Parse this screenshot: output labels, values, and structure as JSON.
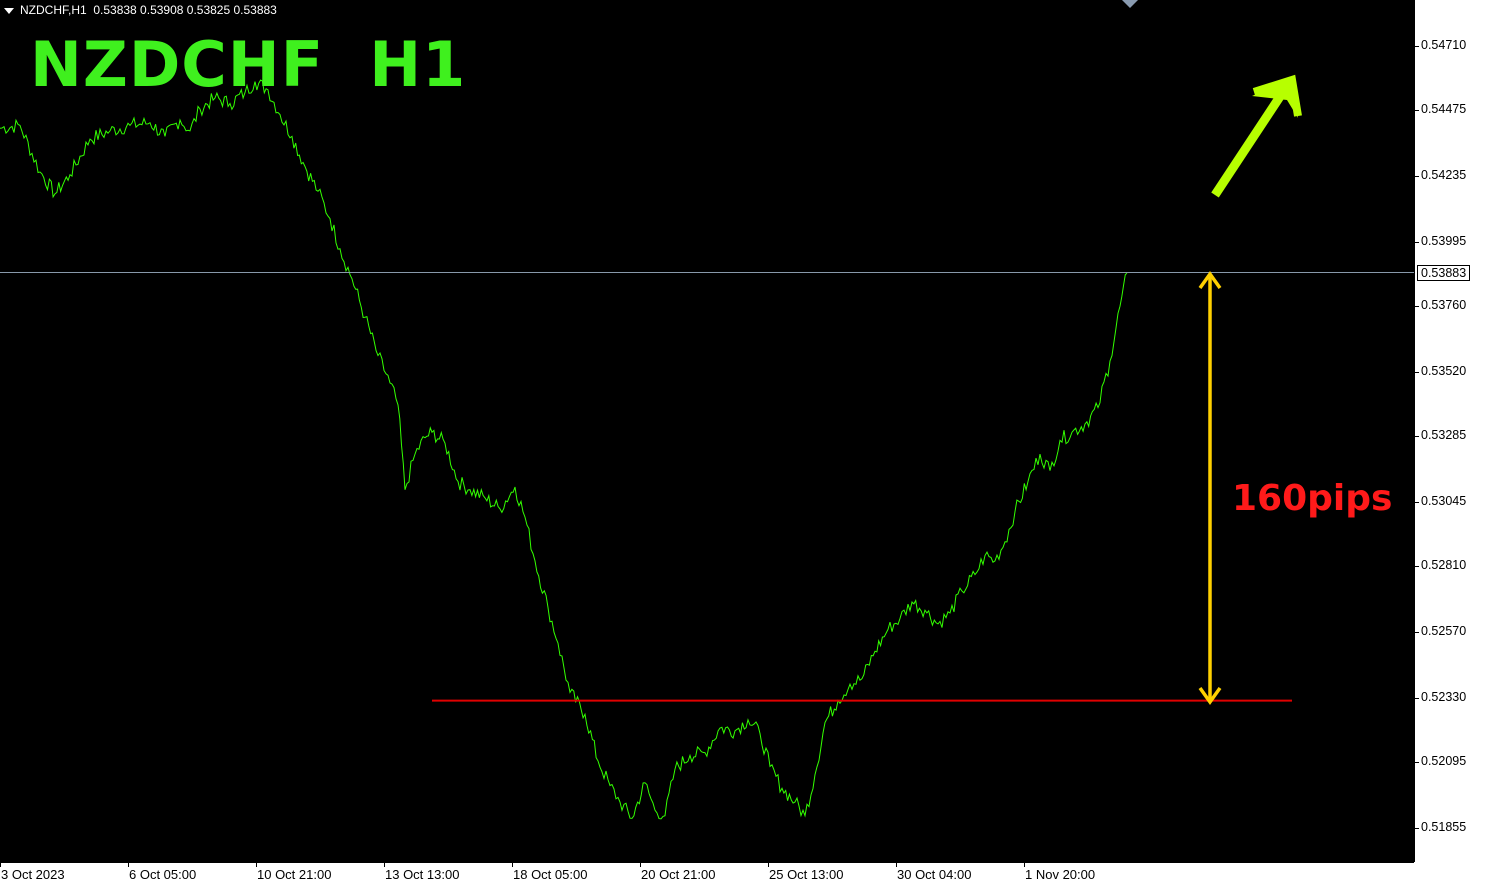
{
  "header": {
    "symbol": "NZDCHF,H1",
    "ohlc": "0.53838 0.53908 0.53825 0.53883"
  },
  "title": "NZDCHF  H1",
  "annotation": {
    "pips_label": "160pips",
    "support_price": 0.5232,
    "arrow_color": "#b7ff00",
    "pips_color": "#ff1a1a",
    "support_color": "#e00000",
    "measure_color": "#ffd000"
  },
  "price_axis": {
    "ticks": [
      "0.54710",
      "0.54475",
      "0.54235",
      "0.53995",
      "0.53760",
      "0.53520",
      "0.53285",
      "0.53045",
      "0.52810",
      "0.52570",
      "0.52330",
      "0.52095",
      "0.51855"
    ],
    "current_price": "0.53883"
  },
  "time_axis": {
    "ticks": [
      "3 Oct 2023",
      "6 Oct 05:00",
      "10 Oct 21:00",
      "13 Oct 13:00",
      "18 Oct 05:00",
      "20 Oct 21:00",
      "25 Oct 13:00",
      "30 Oct 04:00",
      "1 Nov 20:00"
    ]
  },
  "chart_data": {
    "type": "line",
    "title": "NZDCHF  H1",
    "xlabel": "",
    "ylabel": "",
    "ylim": [
      0.5178,
      0.5482
    ],
    "line_color": "#33ff00",
    "series": [
      {
        "x_index": [
          0,
          20,
          40,
          55,
          70,
          90,
          110,
          130,
          150,
          165,
          180,
          190,
          200,
          215,
          230,
          245,
          255,
          268,
          280,
          292,
          305,
          318,
          330,
          340,
          352,
          365,
          378,
          390,
          398,
          405,
          415,
          425,
          432,
          445,
          458,
          470,
          485,
          500,
          515,
          525,
          535,
          548,
          558,
          570,
          585,
          598,
          610,
          620,
          632,
          645,
          655,
          665,
          675,
          690,
          705,
          720,
          735,
          748,
          760,
          770,
          782,
          795,
          805,
          815,
          825,
          838,
          850,
          862,
          875,
          888,
          900,
          912,
          925,
          938,
          950,
          962,
          975,
          985,
          995,
          1005,
          1015,
          1028,
          1040,
          1050,
          1060,
          1072,
          1085,
          1098,
          1110,
          1120,
          1127
        ],
        "values": [
          0.5441,
          0.5442,
          0.5425,
          0.5417,
          0.5424,
          0.5437,
          0.544,
          0.5442,
          0.5443,
          0.5438,
          0.5444,
          0.544,
          0.5448,
          0.5452,
          0.545,
          0.5454,
          0.5458,
          0.5455,
          0.5446,
          0.5438,
          0.5427,
          0.5418,
          0.5408,
          0.5397,
          0.5386,
          0.5372,
          0.5358,
          0.5348,
          0.534,
          0.5309,
          0.5322,
          0.5328,
          0.533,
          0.5326,
          0.5312,
          0.5309,
          0.5306,
          0.5302,
          0.531,
          0.5299,
          0.5283,
          0.5266,
          0.5253,
          0.5235,
          0.5227,
          0.521,
          0.5201,
          0.5195,
          0.5189,
          0.5202,
          0.5192,
          0.519,
          0.5207,
          0.5212,
          0.5213,
          0.5222,
          0.5221,
          0.5225,
          0.522,
          0.5208,
          0.52,
          0.5195,
          0.519,
          0.5205,
          0.5224,
          0.5232,
          0.5238,
          0.524,
          0.525,
          0.5258,
          0.5262,
          0.5268,
          0.5265,
          0.526,
          0.5264,
          0.5272,
          0.5278,
          0.5285,
          0.5283,
          0.529,
          0.5301,
          0.5312,
          0.5322,
          0.5316,
          0.5327,
          0.533,
          0.5333,
          0.5339,
          0.5356,
          0.5376,
          0.5388
        ]
      }
    ]
  }
}
